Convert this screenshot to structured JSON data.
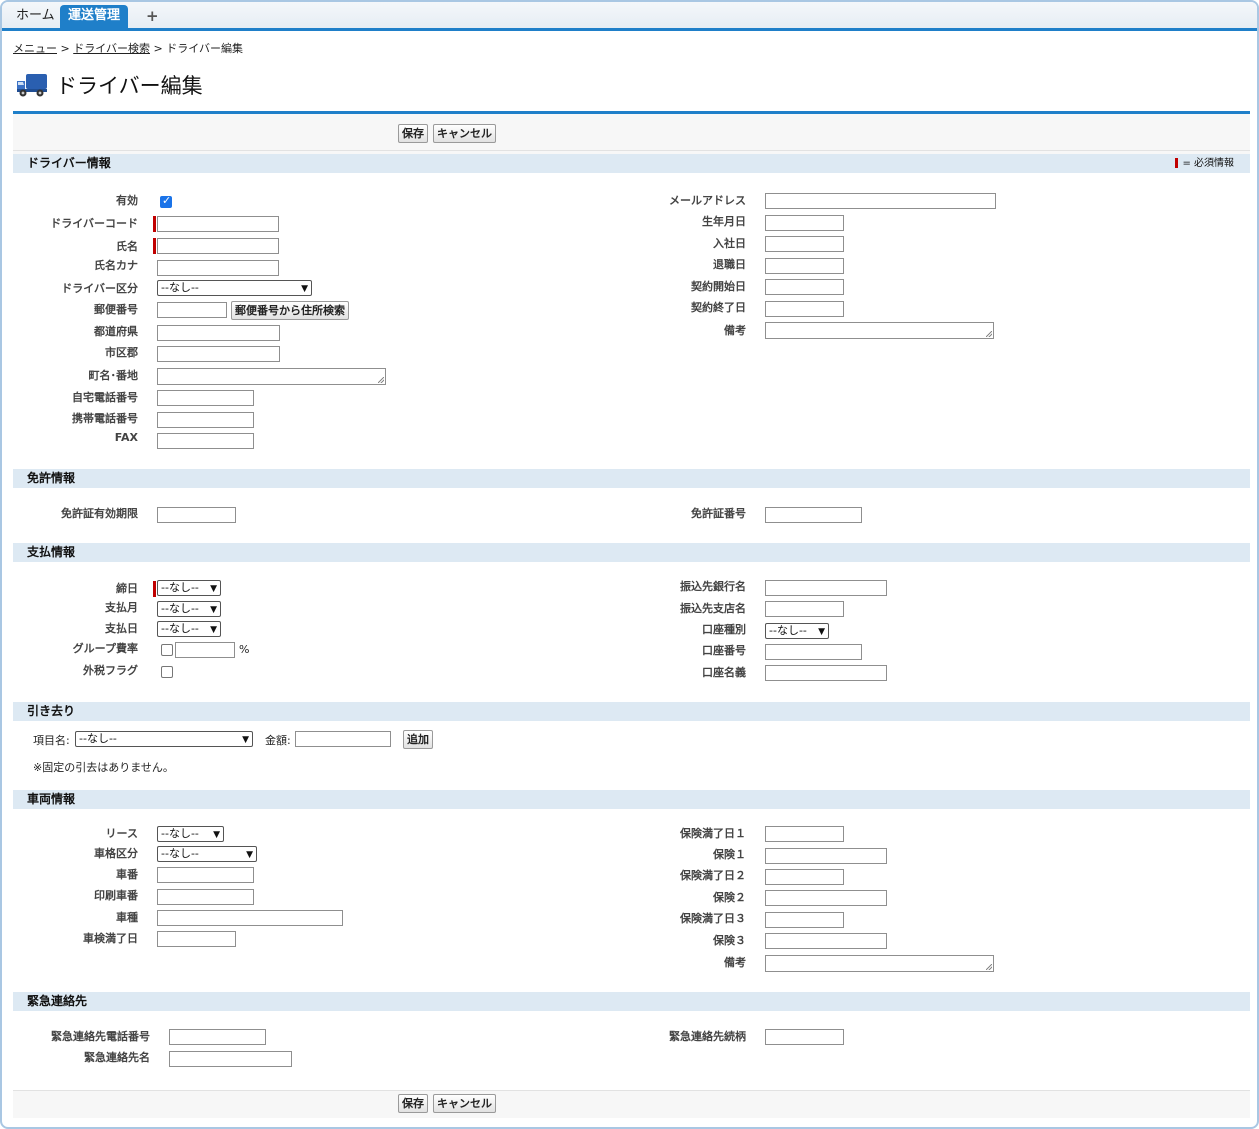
{
  "tabs": [
    {
      "label": "ホーム"
    },
    {
      "label": "運送管理"
    },
    {
      "label": "+"
    }
  ],
  "breadcrumb": {
    "menu": "メニュー",
    "search": "ドライバー検索",
    "current": "ドライバー編集",
    "sep": ">"
  },
  "page": {
    "title": "ドライバー編集",
    "icon": "truck-icon"
  },
  "actions": {
    "save": "保存",
    "cancel": "キャンセル"
  },
  "required_note": "= 必須情報",
  "sections": {
    "driver": {
      "title": "ドライバー情報",
      "left": {
        "active": "有効",
        "code": "ドライバーコード",
        "name": "氏名",
        "kana": "氏名カナ",
        "category": "ドライバー区分",
        "zip": "郵便番号",
        "zip_search": "郵便番号から住所検索",
        "pref": "都道府県",
        "city": "市区郡",
        "town": "町名･番地",
        "home_tel": "自宅電話番号",
        "mobile_tel": "携帯電話番号",
        "fax": "FAX"
      },
      "right": {
        "email": "メールアドレス",
        "birthday": "生年月日",
        "joined": "入社日",
        "retired": "退職日",
        "contract_start": "契約開始日",
        "contract_end": "契約終了日",
        "note": "備考"
      }
    },
    "license": {
      "title": "免許情報",
      "expiry": "免許証有効期限",
      "number": "免許証番号"
    },
    "payment": {
      "title": "支払情報",
      "closing": "締日",
      "pay_month": "支払月",
      "pay_day": "支払日",
      "group_rate": "グループ費率",
      "percent": "%",
      "tax_flag": "外税フラグ",
      "bank": "振込先銀行名",
      "branch": "振込先支店名",
      "account_type": "口座種別",
      "account_no": "口座番号",
      "account_name": "口座名義"
    },
    "deduction": {
      "title": "引き去り",
      "item": "項目名:",
      "amount": "金額:",
      "add": "追加",
      "empty_note": "※固定の引去はありません。"
    },
    "vehicle": {
      "title": "車両情報",
      "lease": "リース",
      "class": "車格区分",
      "number": "車番",
      "print_number": "印刷車番",
      "type": "車種",
      "inspection": "車検満了日",
      "ins_exp1": "保険満了日１",
      "ins1": "保険１",
      "ins_exp2": "保険満了日２",
      "ins2": "保険２",
      "ins_exp3": "保険満了日３",
      "ins3": "保険３",
      "note": "備考"
    },
    "emergency": {
      "title": "緊急連絡先",
      "tel": "緊急連絡先電話番号",
      "name": "緊急連絡先名",
      "relation": "緊急連絡先続柄"
    }
  },
  "select_default": "--なし--",
  "fields": {
    "active_checked": true,
    "group_rate_checked": false,
    "tax_flag_checked": false
  },
  "colors": {
    "accent": "#1f7fc9",
    "required": "#c00000",
    "section_bg": "#dde9f3"
  }
}
